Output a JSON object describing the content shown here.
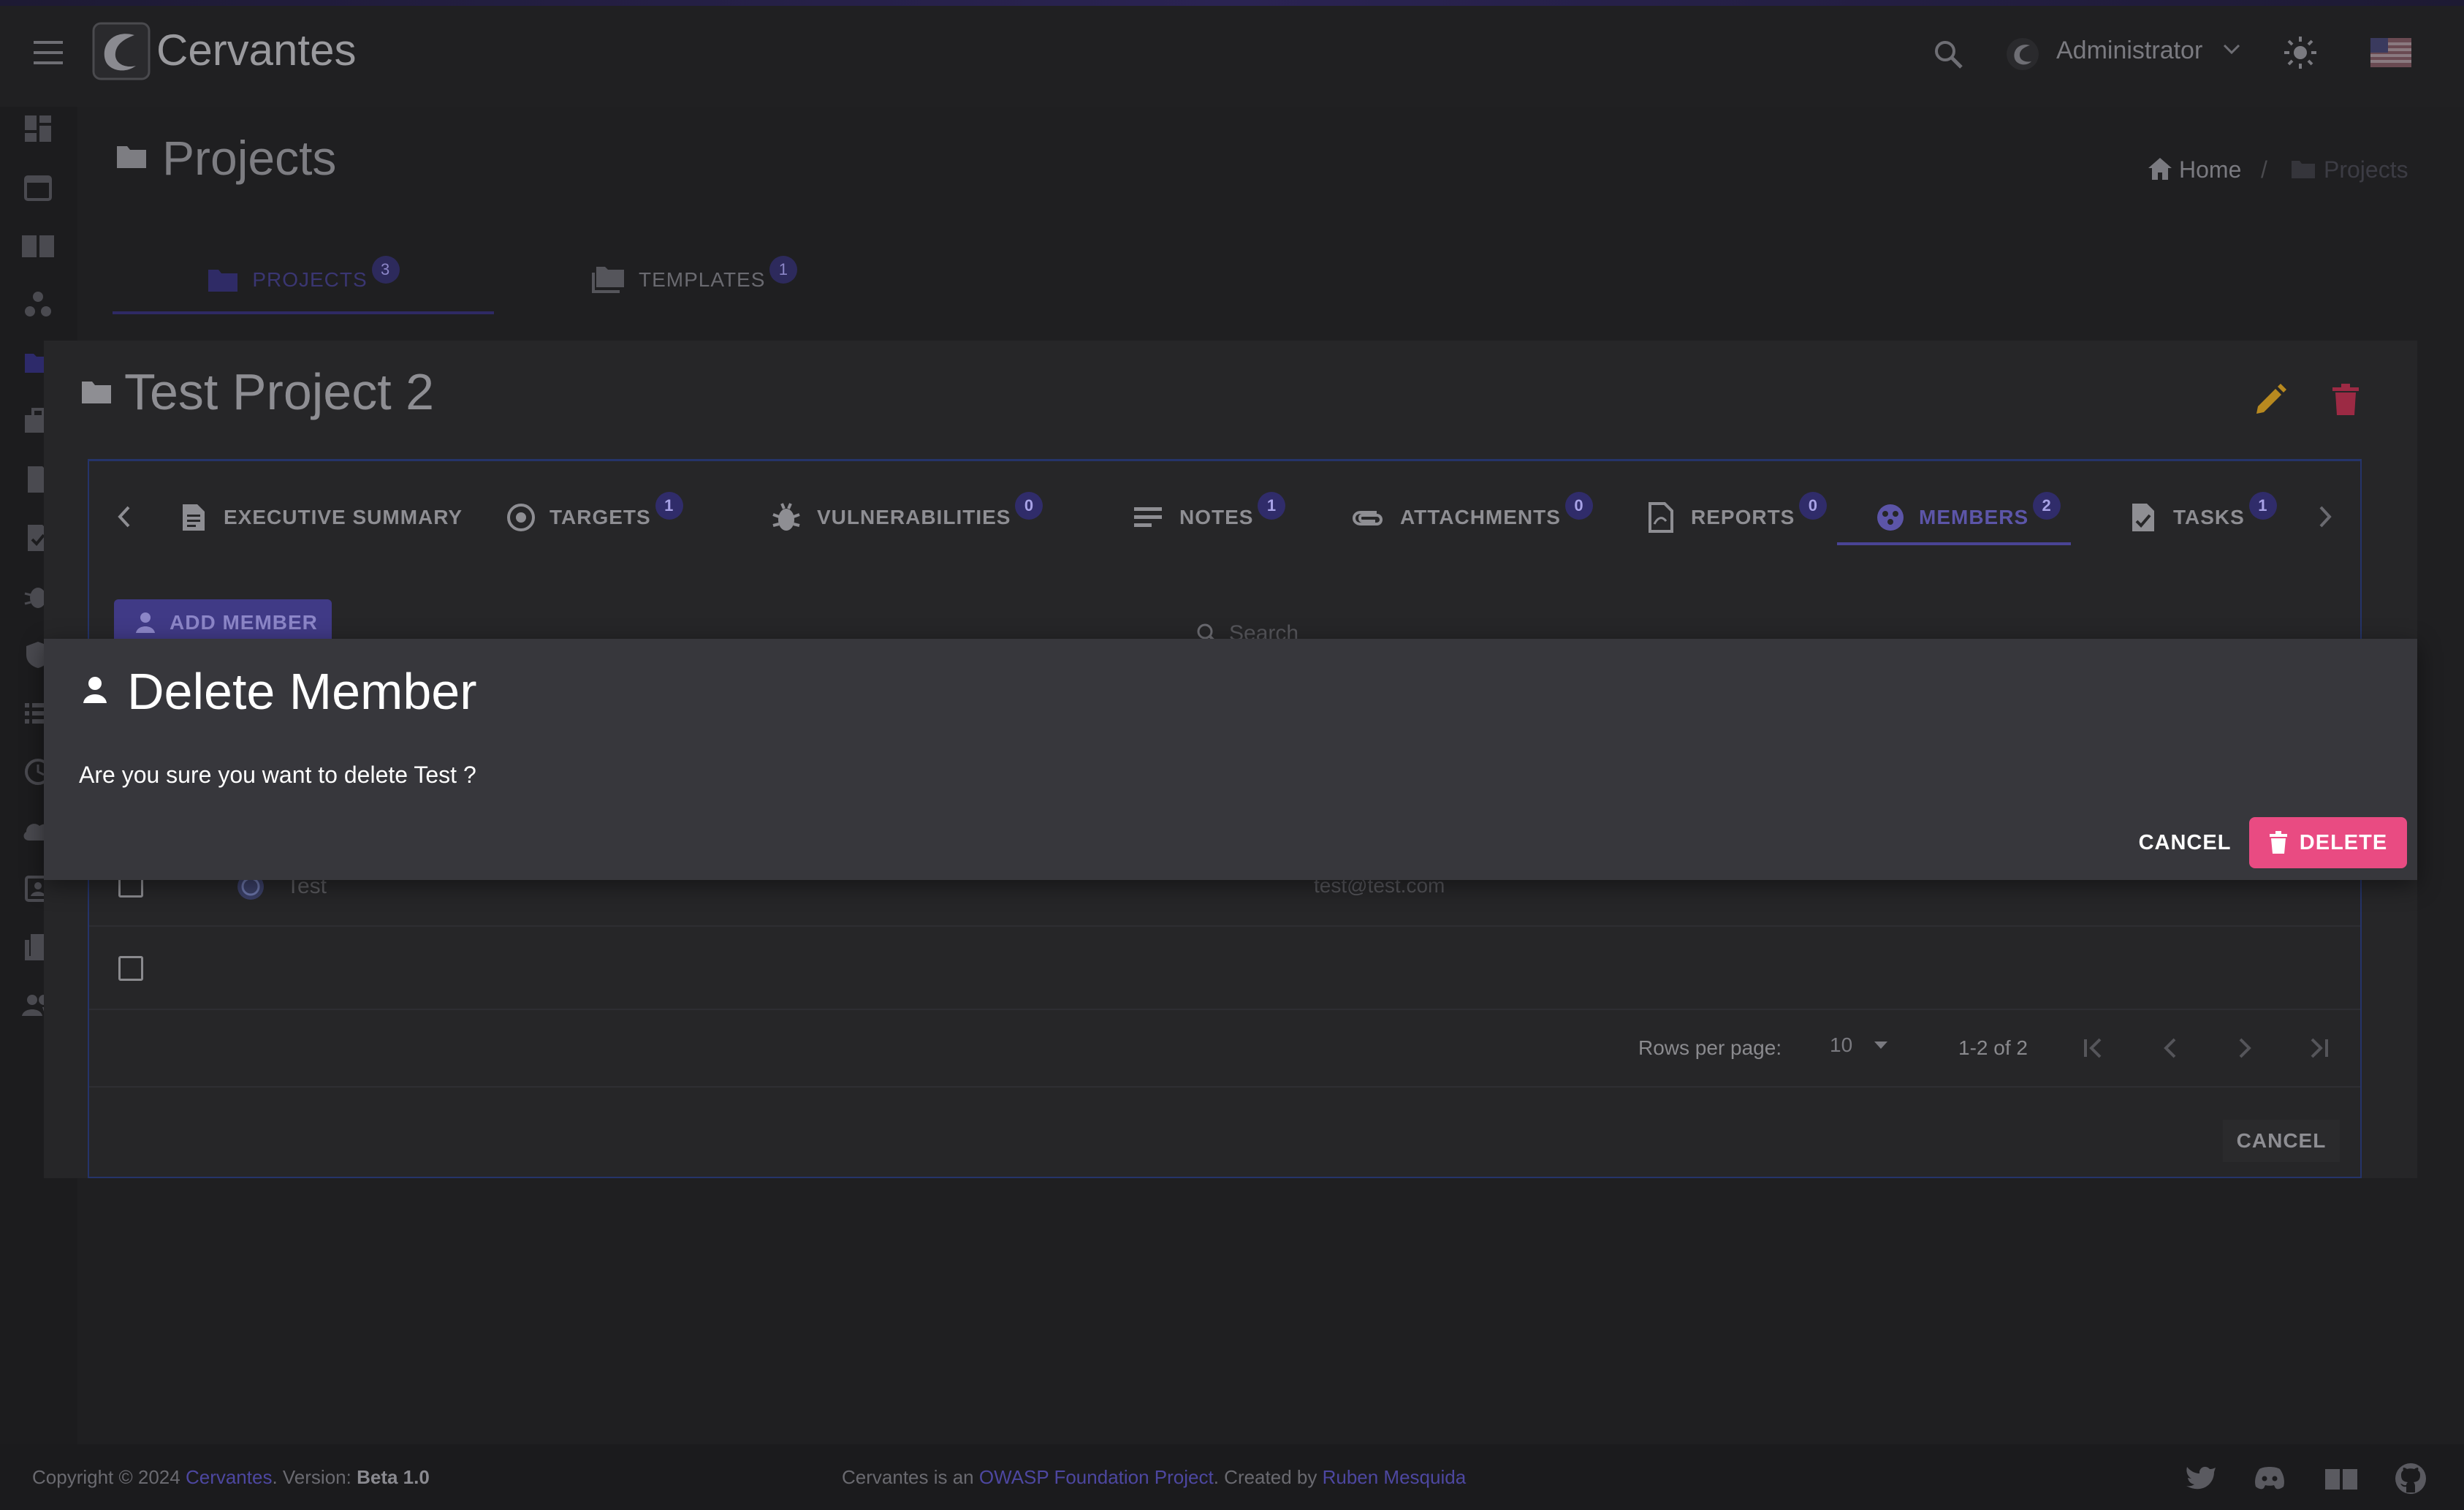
{
  "app": {
    "title": "Cervantes",
    "user": "Administrator"
  },
  "page": {
    "title": "Projects"
  },
  "breadcrumb": {
    "home": "Home",
    "separator": "/",
    "current": "Projects"
  },
  "page_tabs": [
    {
      "label": "PROJECTS",
      "count": "3",
      "active": true
    },
    {
      "label": "TEMPLATES",
      "count": "1",
      "active": false
    }
  ],
  "project": {
    "title": "Test Project 2"
  },
  "project_tabs": [
    {
      "label": "EXECUTIVE SUMMARY",
      "count": ""
    },
    {
      "label": "TARGETS",
      "count": "1"
    },
    {
      "label": "VULNERABILITIES",
      "count": "0"
    },
    {
      "label": "NOTES",
      "count": "1"
    },
    {
      "label": "ATTACHMENTS",
      "count": "0"
    },
    {
      "label": "REPORTS",
      "count": "0"
    },
    {
      "label": "MEMBERS",
      "count": "2",
      "active": true
    },
    {
      "label": "TASKS",
      "count": "1"
    }
  ],
  "members": {
    "add_button": "ADD MEMBER",
    "search_placeholder": "Search",
    "rows": [
      {
        "name": "Test",
        "email": "test@test.com"
      },
      {
        "name": "",
        "email": ""
      }
    ],
    "rows_per_page_label": "Rows per page:",
    "rows_per_page": "10",
    "range": "1-2 of 2",
    "cancel": "CANCEL"
  },
  "dialog": {
    "title": "Delete Member",
    "text": "Are you sure you want to delete Test ?",
    "cancel": "CANCEL",
    "delete": "DELETE"
  },
  "footer": {
    "copyright_prefix": "Copyright © 2024",
    "copyright_link": "Cervantes",
    "version_label": ". Version:",
    "version": "Beta 1.0",
    "middle_prefix": "Cervantes is an",
    "owasp_link": "OWASP Foundation Project",
    "created_by": ". Created by",
    "author_link": "Ruben Mesquida"
  },
  "colors": {
    "accent": "#5c55a8",
    "danger": "#e94b82",
    "edit": "#b8891f",
    "trash": "#9c2a44"
  }
}
